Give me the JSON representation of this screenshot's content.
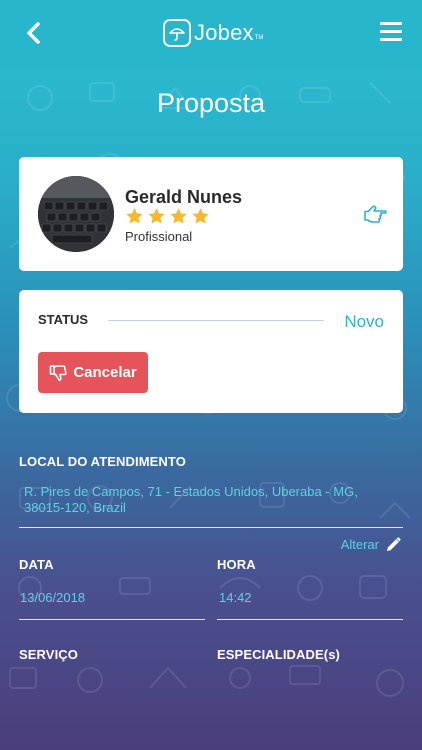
{
  "header": {
    "logo_text": "Jobex",
    "logo_tm": "TM"
  },
  "page": {
    "title": "Proposta"
  },
  "professional": {
    "name": "Gerald Nunes",
    "rating": 4,
    "rating_max": 4,
    "role": "Profissional"
  },
  "status": {
    "label": "STATUS",
    "value": "Novo",
    "cancel_label": "Cancelar"
  },
  "location": {
    "label": "LOCAL DO ATENDIMENTO",
    "address_line1": "R. Pires de Campos, 71 - Estados Unidos, Uberaba - MG,",
    "address_line2": "38015-120, Brazil"
  },
  "schedule": {
    "alter_label": "Alterar",
    "date_label": "DATA",
    "date_value": "13/06/2018",
    "time_label": "HORA",
    "time_value": "14:42"
  },
  "service": {
    "service_label": "SERVIÇO",
    "specialty_label": "ESPECIALIDADE(s)"
  },
  "colors": {
    "topbar": "#27b6cc",
    "accent": "#2fb3c6",
    "cancel": "#e5545a",
    "star": "#f5b82e"
  }
}
